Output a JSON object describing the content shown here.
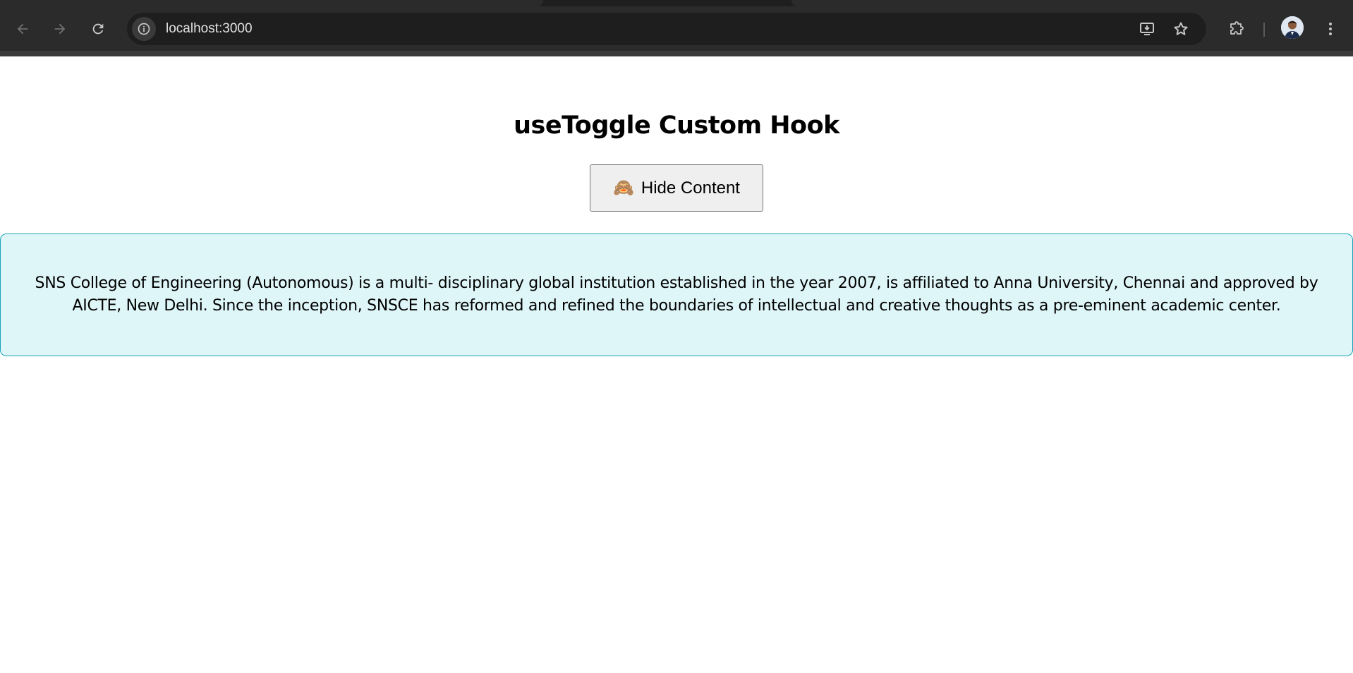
{
  "browser": {
    "url": "localhost:3000",
    "icons": {
      "back": "arrow-left-icon",
      "forward": "arrow-right-icon",
      "reload": "reload-icon",
      "site_info": "info-icon",
      "install": "install-app-icon",
      "bookmark": "star-icon",
      "extensions": "puzzle-icon",
      "profile": "avatar",
      "menu": "kebab-menu-icon"
    }
  },
  "page": {
    "title": "useToggle Custom Hook",
    "toggle_button": {
      "emoji": "🙈",
      "label": "Hide Content"
    },
    "content": {
      "text": "SNS College of Engineering (Autonomous) is a multi- disciplinary global institution established in the year 2007, is affiliated to Anna University, Chennai and approved by AICTE, New Delhi. Since the inception, SNSCE has reformed and refined the boundaries of intellectual and creative thoughts as a pre-eminent academic center."
    }
  },
  "colors": {
    "content_bg": "#dff6f8",
    "content_border": "#17a2b8",
    "chrome_bg": "#2b2b2b"
  }
}
